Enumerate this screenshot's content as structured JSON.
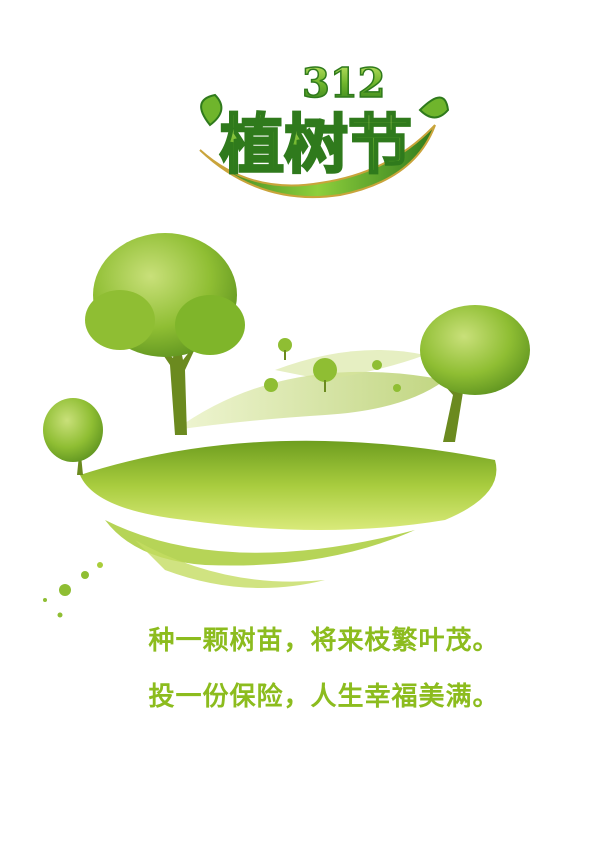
{
  "logo": {
    "number_text": "312",
    "title_text": "植树节",
    "colors": {
      "primary": "#6fb52c",
      "dark": "#2f7a1c",
      "gold": "#c9a43b"
    }
  },
  "slogans": [
    "种一颗树苗，将来枝繁叶茂。",
    "投一份保险，人生幸福美满。"
  ],
  "colors": {
    "slogan": "#8cbc1e",
    "foliage": "#7fb52a",
    "foliage_light": "#b9d66a",
    "trunk": "#6b8a1f"
  }
}
